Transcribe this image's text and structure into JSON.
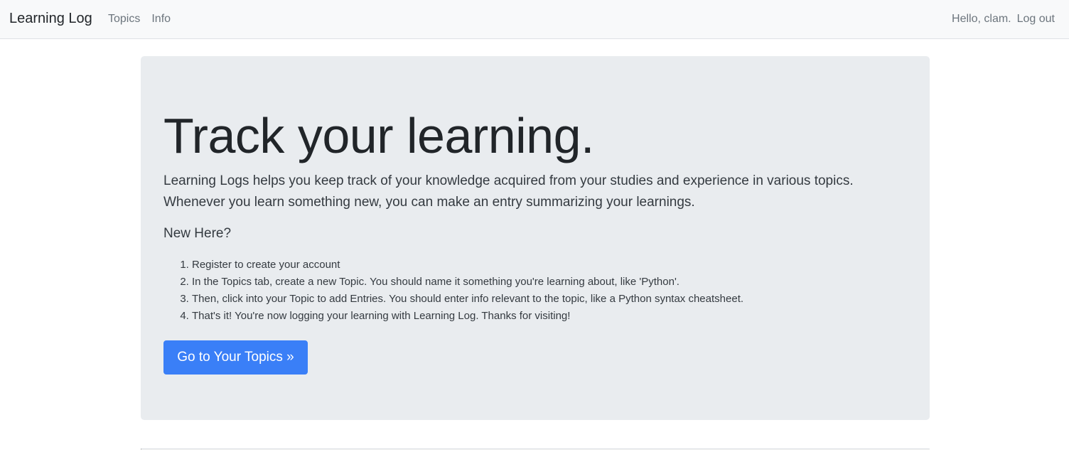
{
  "navbar": {
    "brand": "Learning Log",
    "left_links": [
      {
        "label": "Topics"
      },
      {
        "label": "Info"
      }
    ],
    "greeting": "Hello, clam.",
    "logout_label": "Log out"
  },
  "jumbotron": {
    "heading": "Track your learning.",
    "lead": "Learning Logs helps you keep track of your knowledge acquired from your studies and experience in various topics. Whenever you learn something new, you can make an entry summarizing your learnings.",
    "new_here": "New Here?",
    "steps": [
      "Register to create your account",
      "In the Topics tab, create a new Topic. You should name it something you're learning about, like 'Python'.",
      "Then, click into your Topic to add Entries. You should enter info relevant to the topic, like a Python syntax cheatsheet.",
      "That's it! You're now logging your learning with Learning Log. Thanks for visiting!"
    ],
    "cta_label": "Go to Your Topics »"
  },
  "colors": {
    "navbar_bg": "#f8f9fa",
    "jumbotron_bg": "#e9ecef",
    "primary": "#3a7ff7"
  }
}
